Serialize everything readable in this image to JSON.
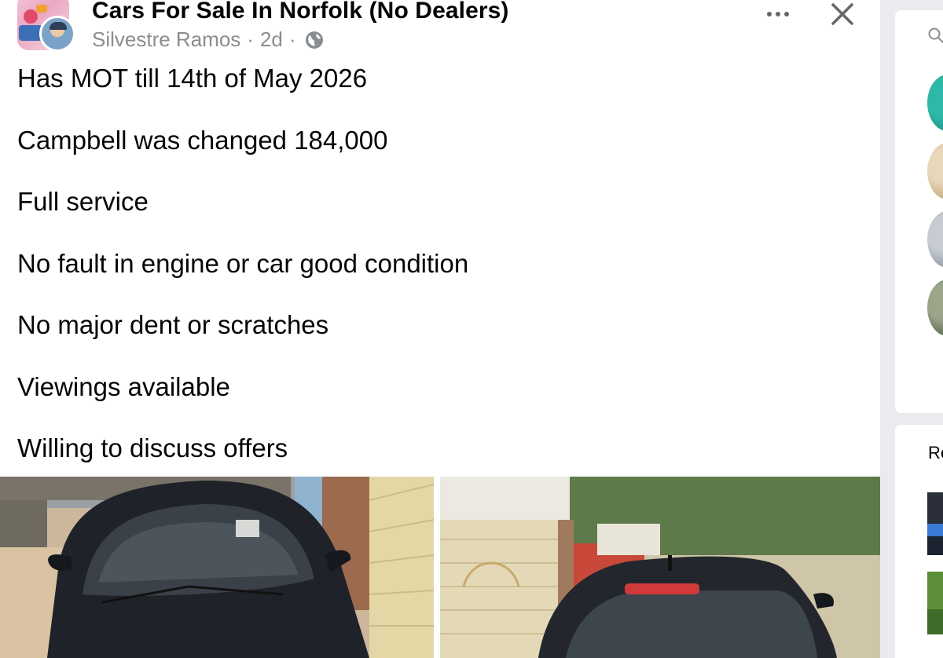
{
  "post": {
    "group_name": "Cars For Sale In Norfolk (No Dealers)",
    "author": "Silvestre Ramos",
    "separator": "·",
    "time": "2d",
    "privacy_icon": "globe-icon",
    "more_icon": "more-horizontal-icon",
    "close_icon": "close-icon",
    "lines": [
      "Has MOT till 14th of May 2026",
      "Campbell was changed 184,000",
      "Full service",
      "No fault in engine or car good condition",
      "No major dent or scratches",
      "Viewings available",
      "Willing to discuss offers"
    ],
    "photos": [
      "car-front-photo",
      "car-rear-photo"
    ]
  },
  "sidebar": {
    "search_icon": "search-icon",
    "heading": "Re"
  },
  "colors": {
    "text_primary": "#050505",
    "text_secondary": "#8a8d91",
    "sidebar_bg": "#e9ebee"
  }
}
